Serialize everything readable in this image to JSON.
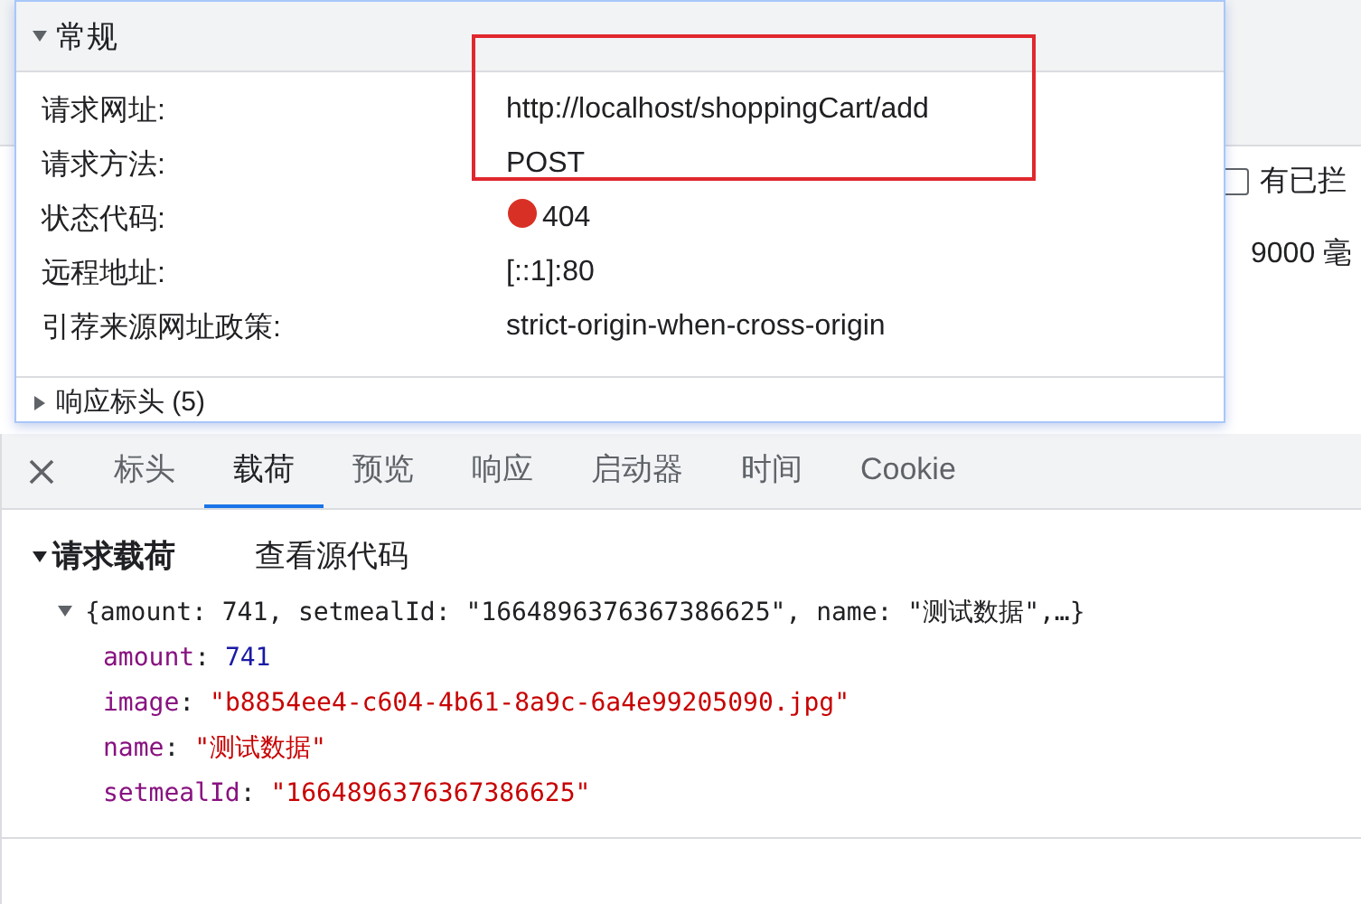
{
  "background": {
    "checkbox": {
      "label": "有已拦",
      "checked": false
    },
    "cell": "9000 毫"
  },
  "general": {
    "title": "常规",
    "expanded": true,
    "rows": [
      {
        "label": "请求网址:",
        "value": "http://localhost/shoppingCart/add",
        "highlighted": true
      },
      {
        "label": "请求方法:",
        "value": "POST",
        "highlighted": true
      },
      {
        "label": "状态代码:",
        "value": "404",
        "highlighted": false,
        "color": "#d93025"
      },
      {
        "label": "远程地址:",
        "value": "[::1]:80",
        "highlighted": false
      },
      {
        "label": "引荐来源网址政策:",
        "value": "strict-origin-when-cross-origin",
        "highlighted": false
      }
    ],
    "next_section": {
      "title": "响应标头 (5)",
      "expanded": false
    }
  },
  "tabs": [
    {
      "label": "标头",
      "selected": false
    },
    {
      "label": "载荷",
      "selected": true
    },
    {
      "label": "预览",
      "selected": false
    },
    {
      "label": "响应",
      "selected": false
    },
    {
      "label": "启动器",
      "selected": false
    },
    {
      "label": "时间",
      "selected": false
    },
    {
      "label": "Cookie",
      "selected": false
    }
  ],
  "payload": {
    "title": "请求载荷",
    "expanded": true,
    "view_source": "查看源代码",
    "object": {
      "summary": "{amount: 741, setmealId: \"1664896376367386625\", name: \"测试数据\",…}",
      "expanded": true,
      "separator": ":",
      "properties": [
        {
          "key": "amount",
          "value": "741",
          "kind": "number"
        },
        {
          "key": "image",
          "value": "\"b8854ee4-c604-4b61-8a9c-6a4e99205090.jpg\"",
          "kind": "string"
        },
        {
          "key": "name",
          "value": "\"测试数据\"",
          "kind": "string"
        },
        {
          "key": "setmealId",
          "value": "\"1664896376367386625\"",
          "kind": "string"
        }
      ]
    }
  }
}
